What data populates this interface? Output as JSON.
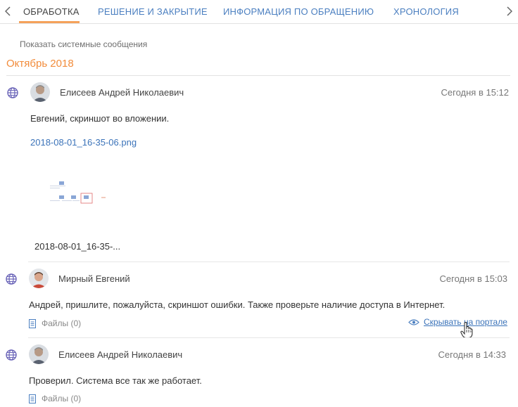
{
  "tabs": {
    "items": [
      {
        "label": "ОБРАБОТКА"
      },
      {
        "label": "РЕШЕНИЕ И ЗАКРЫТИЕ"
      },
      {
        "label": "ИНФОРМАЦИЯ ПО ОБРАЩЕНИЮ"
      },
      {
        "label": "ХРОНОЛОГИЯ"
      }
    ],
    "active_index": 0
  },
  "show_system_messages": "Показать системные сообщения",
  "month_group": "Октябрь 2018",
  "messages": [
    {
      "author": "Елисеев Андрей Николаевич",
      "date": "Сегодня в 15:12",
      "text": "Евгений, скриншот во вложении.",
      "attachment_link": "2018-08-01_16-35-06.png",
      "attachment_caption": "2018-08-01_16-35-...",
      "channel_icon": "globe-icon"
    },
    {
      "author": "Мирный Евгений",
      "date": "Сегодня в 15:03",
      "text": "Андрей, пришлите, пожалуйста, скриншот ошибки. Также проверьте наличие доступа в Интернет.",
      "files": "Файлы (0)",
      "hide_link": "Скрывать на портале",
      "channel_icon": "globe-icon"
    },
    {
      "author": "Елисеев Андрей Николаевич",
      "date": "Сегодня в 14:33",
      "text": "Проверил. Система все так же работает.",
      "files": "Файлы (0)",
      "channel_icon": "globe-icon"
    }
  ],
  "colors": {
    "accent": "#f28c3b",
    "link": "#3b73b9",
    "tab_link": "#4b7fc0"
  }
}
